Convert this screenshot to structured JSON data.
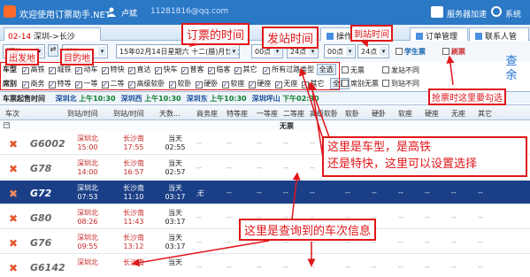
{
  "titlebar": {
    "app_title": "欢迎使用订票助手.NET",
    "username": "卢斌",
    "user_qq": "11281816@qq.com",
    "service_label": "服务器加速",
    "system_label": "系统"
  },
  "tabs": {
    "active_num": "02-14",
    "active_route": "深圳->长沙",
    "operation": "操作中心",
    "orders": "订单管理",
    "contacts": "联系人管理"
  },
  "search": {
    "from_station": "深圳",
    "swap_label": "⇄",
    "to_station": "长沙",
    "date": "15年02月14日星期六 十二(腊)月廿六",
    "time_from": "00点",
    "time_to": "24点",
    "time_from2": "00点",
    "time_to2": "24点",
    "student_ticket": "学生票",
    "brush_ticket": "刷票",
    "search_btn_line1": "查",
    "search_btn_line2": "余"
  },
  "filters": {
    "type_label": "车型",
    "types": [
      "高铁",
      "城铁",
      "动车",
      "特快",
      "直达",
      "快车",
      "普客",
      "临客",
      "其它"
    ],
    "pass_label": "所有过路类型",
    "all_label": "全选",
    "seat_label": "席别",
    "seats": [
      "商务",
      "特等",
      "一等",
      "二等",
      "高级软卧",
      "软卧",
      "硬卧",
      "软座",
      "硬座",
      "无座",
      "其它"
    ],
    "seat_all_label": "全选",
    "no_seat": "无票",
    "seat_no_ticket": "席别无票",
    "start_diff": "发站不同",
    "arrive_diff": "到站不同"
  },
  "datestrip": {
    "head": "车票起售时间",
    "entries": [
      {
        "station": "深圳北",
        "time": "上午10:30"
      },
      {
        "station": "深圳西",
        "time": "上午10:30"
      },
      {
        "station": "深圳东",
        "time": "上午10:30"
      },
      {
        "station": "深圳坪山",
        "time": "下午02:30"
      }
    ]
  },
  "table": {
    "headers": [
      "车次",
      "到站/时间",
      "到站/时间",
      "天数...",
      "商务座",
      "特等座",
      "一等座",
      "二等座",
      "高级软卧",
      "软卧",
      "硬卧",
      "软座",
      "硬座",
      "无座",
      "其它"
    ],
    "group_label": "无票",
    "rows": [
      {
        "code": "G6002",
        "from": "深圳北",
        "from_time": "15:00",
        "to": "长沙南",
        "to_time": "17:55",
        "day": "当天",
        "dur": "02:55",
        "selected": false,
        "seats": [
          "--",
          "--",
          "--",
          "--",
          "--",
          "--",
          "--",
          "--",
          "--",
          "--",
          "--"
        ]
      },
      {
        "code": "G78",
        "from": "深圳北",
        "from_time": "14:00",
        "to": "长沙南",
        "to_time": "16:57",
        "day": "当天",
        "dur": "02:57",
        "selected": false,
        "seats": [
          "--",
          "--",
          "--",
          "--",
          "--",
          "--",
          "--",
          "--",
          "--",
          "--",
          "--"
        ]
      },
      {
        "code": "G72",
        "from": "深圳北",
        "from_time": "07:53",
        "to": "长沙南",
        "to_time": "11:10",
        "day": "当天",
        "dur": "03:17",
        "selected": true,
        "seats": [
          "无",
          "--",
          "--",
          "--",
          "--",
          "--",
          "--",
          "--",
          "--",
          "--",
          "--"
        ]
      },
      {
        "code": "G80",
        "from": "深圳北",
        "from_time": "08:26",
        "to": "长沙南",
        "to_time": "11:43",
        "day": "当天",
        "dur": "03:17",
        "selected": false,
        "seats": [
          "--",
          "--",
          "--",
          "--",
          "--",
          "--",
          "--",
          "--",
          "--",
          "--",
          "--"
        ]
      },
      {
        "code": "G76",
        "from": "深圳北",
        "from_time": "09:55",
        "to": "长沙南",
        "to_time": "13:12",
        "day": "当天",
        "dur": "03:17",
        "selected": false,
        "seats": [
          "--",
          "--",
          "--",
          "--",
          "--",
          "--",
          "--",
          "--",
          "--",
          "--",
          "--"
        ]
      },
      {
        "code": "G6142",
        "from": "深圳北",
        "from_time": "",
        "to": "长沙南",
        "to_time": "",
        "day": "当天",
        "dur": "",
        "selected": false,
        "seats": [
          "--",
          "--",
          "--",
          "--",
          "--",
          "--",
          "--",
          "--",
          "--",
          "--",
          "--"
        ]
      }
    ]
  },
  "annotations": {
    "start_station": "出发地",
    "destination": "目的地",
    "ticket_time": "订票的时间",
    "depart_time": "发站时间",
    "arrive_time": "到站时间",
    "brush_hint": "抢票时这里要勾选",
    "type_hint_line1": "这里是车型，是高铁",
    "type_hint_line2": "还是特快，这里可以设置选择",
    "result_hint": "这里是查询到的车次信息"
  }
}
